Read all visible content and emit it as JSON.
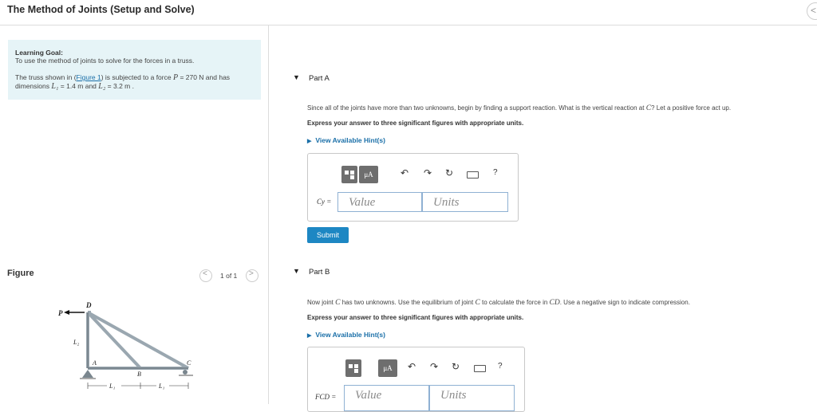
{
  "header": {
    "title": "The Method of Joints (Setup and Solve)",
    "nav_glyph": "<"
  },
  "learning_goal": {
    "heading": "Learning Goal:",
    "text": "To use the method of joints to solve for the forces in a truss.",
    "p_before_link": "The truss shown in (",
    "link": "Figure 1",
    "p_after_link": ") is subjected to a force ",
    "force_var": "P",
    "force_value": " = 270 N and has dimensions ",
    "l1_var": "L₁",
    "l1_value": " = 1.4 m and ",
    "l2_var": "L₂",
    "l2_value": " = 3.2 m ."
  },
  "figure": {
    "label": "Figure",
    "pager": "1 of 1",
    "labels": {
      "D": "D",
      "P": "P",
      "L2": "L₂",
      "A": "A",
      "B": "B",
      "C": "C",
      "L1a": "L₁",
      "L1b": "L₁"
    }
  },
  "partA": {
    "label": "Part A",
    "question_before": "Since all of the joints have more than two unknowns, begin by finding a support reaction. What is the vertical reaction at ",
    "question_var": "C",
    "question_after": "? Let a positive force act up.",
    "instruction": "Express your answer to three significant figures with appropriate units.",
    "hint": "View Available Hint(s)",
    "var_label": "Cy =",
    "value_placeholder": "Value",
    "units_placeholder": "Units",
    "submit": "Submit"
  },
  "partB": {
    "label": "Part B",
    "question_before": "Now joint ",
    "question_var1": "C",
    "question_mid": " has two unknowns. Use the equilibrium of joint ",
    "question_var2": "C",
    "question_mid2": " to calculate the force in ",
    "question_var3": "CD",
    "question_after": ". Use a negative sign to indicate compression.",
    "instruction": "Express your answer to three significant figures with appropriate units.",
    "hint": "View Available Hint(s)",
    "var_label": "FCD =",
    "value_placeholder": "Value",
    "units_placeholder": "Units"
  },
  "toolbar": {
    "units_btn": "μA",
    "undo": "↶",
    "redo": "↷",
    "reset": "↻",
    "help": "?"
  },
  "colors": {
    "accent": "#1d87c3",
    "goal_bg": "#e6f4f7",
    "link": "#1a6fa8"
  }
}
